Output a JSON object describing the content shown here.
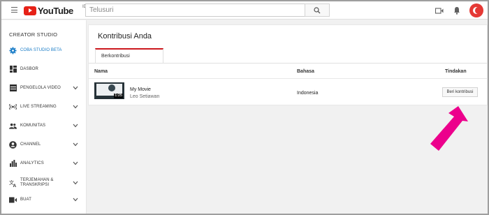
{
  "header": {
    "brand": "YouTube",
    "brand_sup": "ID",
    "search_placeholder": "Telusuri",
    "icons": [
      "menu-icon",
      "search-icon",
      "upload-icon",
      "bell-icon",
      "avatar"
    ]
  },
  "sidebar": {
    "title": "CREATOR STUDIO",
    "items": [
      {
        "label": "COBA STUDIO BETA",
        "icon": "gear-icon",
        "active": true,
        "chevron": false
      },
      {
        "label": "DASBOR",
        "icon": "dashboard-icon",
        "chevron": false
      },
      {
        "label": "PENGELOLA VIDEO",
        "icon": "video-manager-icon",
        "chevron": true
      },
      {
        "label": "LIVE STREAMING",
        "icon": "live-icon",
        "chevron": true
      },
      {
        "label": "KOMUNITAS",
        "icon": "community-icon",
        "chevron": true
      },
      {
        "label": "CHANNEL",
        "icon": "channel-icon",
        "chevron": true
      },
      {
        "label": "ANALYTICS",
        "icon": "analytics-icon",
        "chevron": true
      },
      {
        "label": "TERJEMAHAN & TRANSKRIPSI",
        "label_lines": [
          "TERJEMAHAN &",
          "TRANSKRIPSI"
        ],
        "icon": "translate-icon",
        "chevron": true
      },
      {
        "label": "BUAT",
        "icon": "create-icon",
        "chevron": true
      }
    ]
  },
  "main": {
    "title": "Kontribusi Anda",
    "tab_label": "Berkontribusi",
    "columns": [
      "Nama",
      "Bahasa",
      "Tindakan"
    ],
    "rows": [
      {
        "video_title": "My Movie",
        "owner": "Leo Setiawan",
        "duration": "1:25",
        "language": "Indonesia",
        "action_label": "Beri kontribusi"
      }
    ]
  },
  "colors": {
    "brand_red": "#e62117",
    "tab_accent": "#cc181e",
    "active_blue": "#167ac6",
    "annotation_arrow": "#ec008c"
  }
}
